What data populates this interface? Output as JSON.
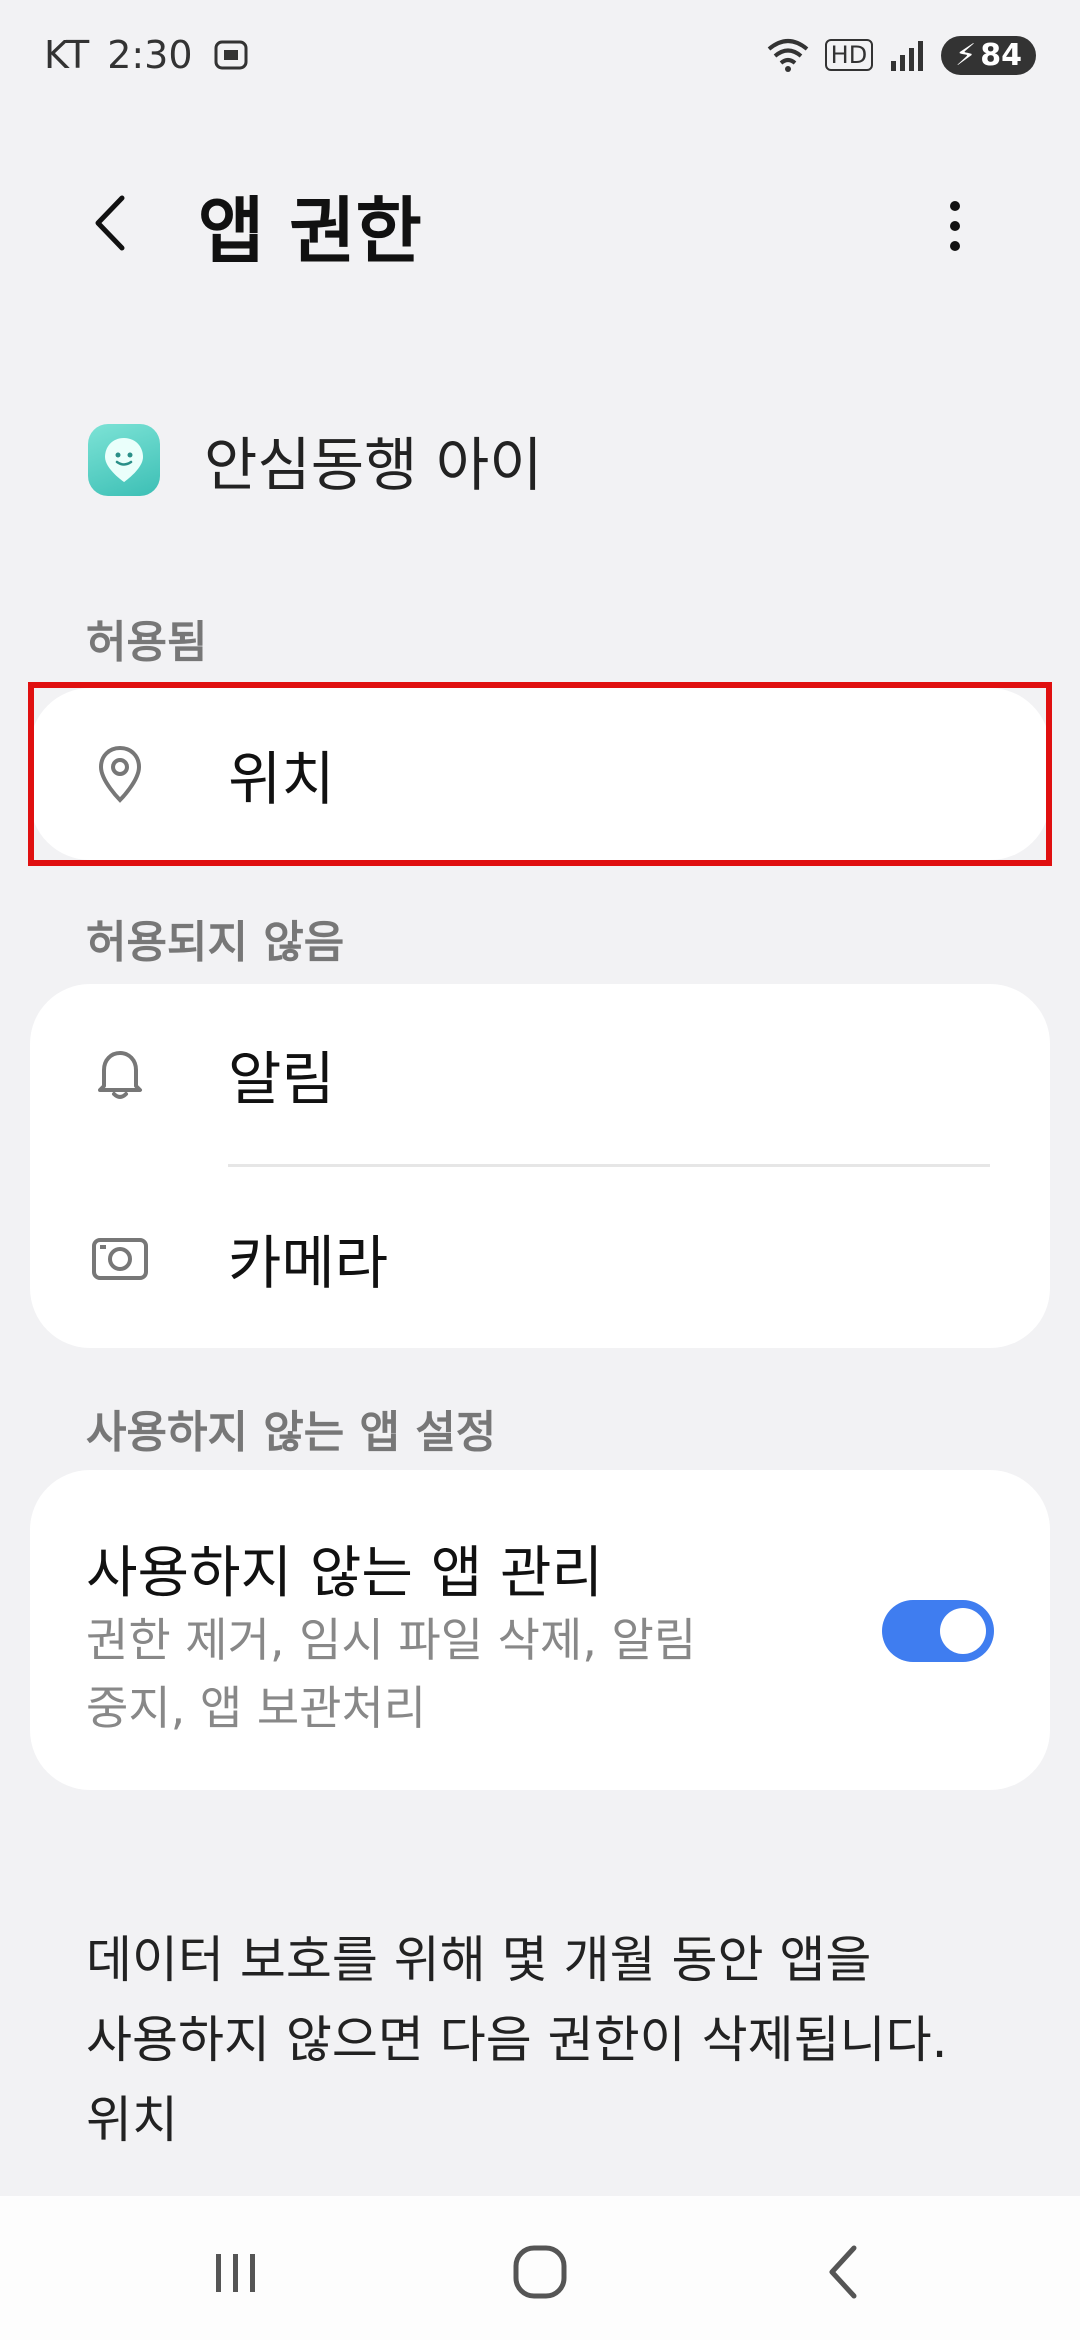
{
  "status_bar": {
    "carrier": "KT",
    "time": "2:30",
    "network_badge": "HD",
    "battery": "84"
  },
  "header": {
    "title": "앱 권한"
  },
  "app": {
    "name": "안심동행 아이"
  },
  "sections": {
    "allowed_label": "허용됨",
    "not_allowed_label": "허용되지 않음",
    "unused_label": "사용하지 않는 앱 설정"
  },
  "permissions": {
    "allowed": [
      {
        "label": "위치",
        "icon": "location-icon"
      }
    ],
    "not_allowed": [
      {
        "label": "알림",
        "icon": "bell-icon"
      },
      {
        "label": "카메라",
        "icon": "camera-icon"
      }
    ]
  },
  "unused_apps": {
    "title": "사용하지 않는 앱 관리",
    "description_line1": "권한 제거, 임시 파일 삭제, 알림",
    "description_line2": "중지, 앱 보관처리",
    "toggle_on": true
  },
  "footer": {
    "line1": "데이터 보호를 위해 몇 개월 동안 앱을",
    "line2": "사용하지 않으면 다음 권한이 삭제됩니다.",
    "line3": "위치"
  },
  "colors": {
    "accent": "#3f7df0",
    "highlight": "#e01010",
    "background": "#f2f2f4"
  }
}
